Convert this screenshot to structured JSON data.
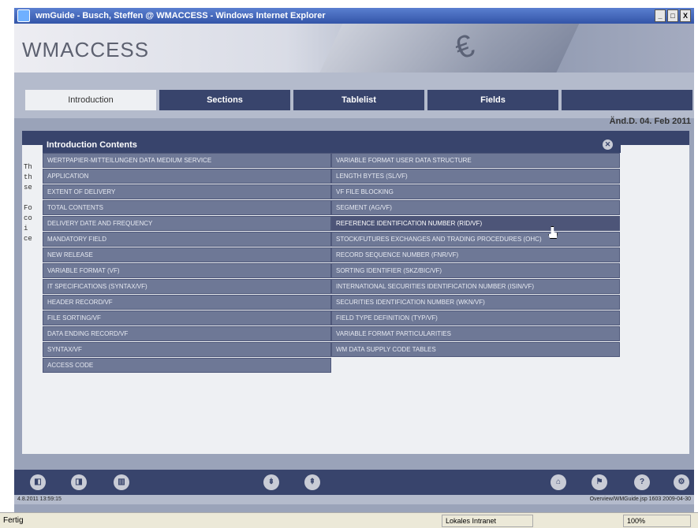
{
  "window": {
    "title": "wmGuide - Busch, Steffen @ WMACCESS - Windows Internet Explorer",
    "btn_min": "_",
    "btn_max": "□",
    "btn_close": "X"
  },
  "app": {
    "logo": "WMACCESS",
    "date": "Änd.D. 04. Feb 2011"
  },
  "tabs": [
    {
      "label": "Introduction"
    },
    {
      "label": "Sections"
    },
    {
      "label": "Tablelist"
    },
    {
      "label": "Fields"
    },
    {
      "label": ""
    }
  ],
  "background_lines": [
    "Th",
    "th",
    "se",
    "",
    "Fo",
    "co",
    "i",
    "ce"
  ],
  "panel": {
    "title": "Introduction Contents",
    "close_glyph": "✕",
    "left_items": [
      "WERTPAPIER-MITTEILUNGEN DATA MEDIUM SERVICE",
      "APPLICATION",
      "EXTENT OF DELIVERY",
      "TOTAL CONTENTS",
      "DELIVERY DATE AND FREQUENCY",
      "MANDATORY FIELD",
      "NEW RELEASE",
      "VARIABLE FORMAT (VF)",
      "IT SPECIFICATIONS (SYNTAX/VF)",
      "HEADER RECORD/VF",
      "FILE SORTING/VF",
      "DATA ENDING RECORD/VF",
      "SYNTAX/VF",
      "ACCESS CODE"
    ],
    "right_items": [
      "VARIABLE FORMAT USER DATA STRUCTURE",
      "LENGTH BYTES (SL/VF)",
      "VF FILE BLOCKING",
      "SEGMENT (AG/VF)",
      "REFERENCE IDENTIFICATION NUMBER (RID/VF)",
      "STOCK/FUTURES EXCHANGES AND TRADING PROCEDURES (OHC)",
      "RECORD SEQUENCE NUMBER (FNR/VF)",
      "SORTING IDENTIFIER (SKZ/BIC/VF)",
      "INTERNATIONAL SECURITIES IDENTIFICATION NUMBER (ISIN/VF)",
      "SECURITIES IDENTIFICATION NUMBER (WKN/VF)",
      "FIELD TYPE DEFINITION (TYP/VF)",
      "VARIABLE FORMAT PARTICULARITIES",
      "WM DATA SUPPLY CODE TABLES"
    ]
  },
  "footer": {
    "left": "4.8.2011 13:59:15",
    "right": "Overview/WMGuide.jsp 1603 2009-04-30"
  },
  "bottom_icons": [
    "◧",
    "◨",
    "▥",
    "⇟",
    "⇞",
    "⌂",
    "⚑",
    "?",
    "⚙"
  ],
  "status": {
    "left": "Fertig",
    "zone": "Lokales Intranet",
    "zoom": "100%"
  }
}
